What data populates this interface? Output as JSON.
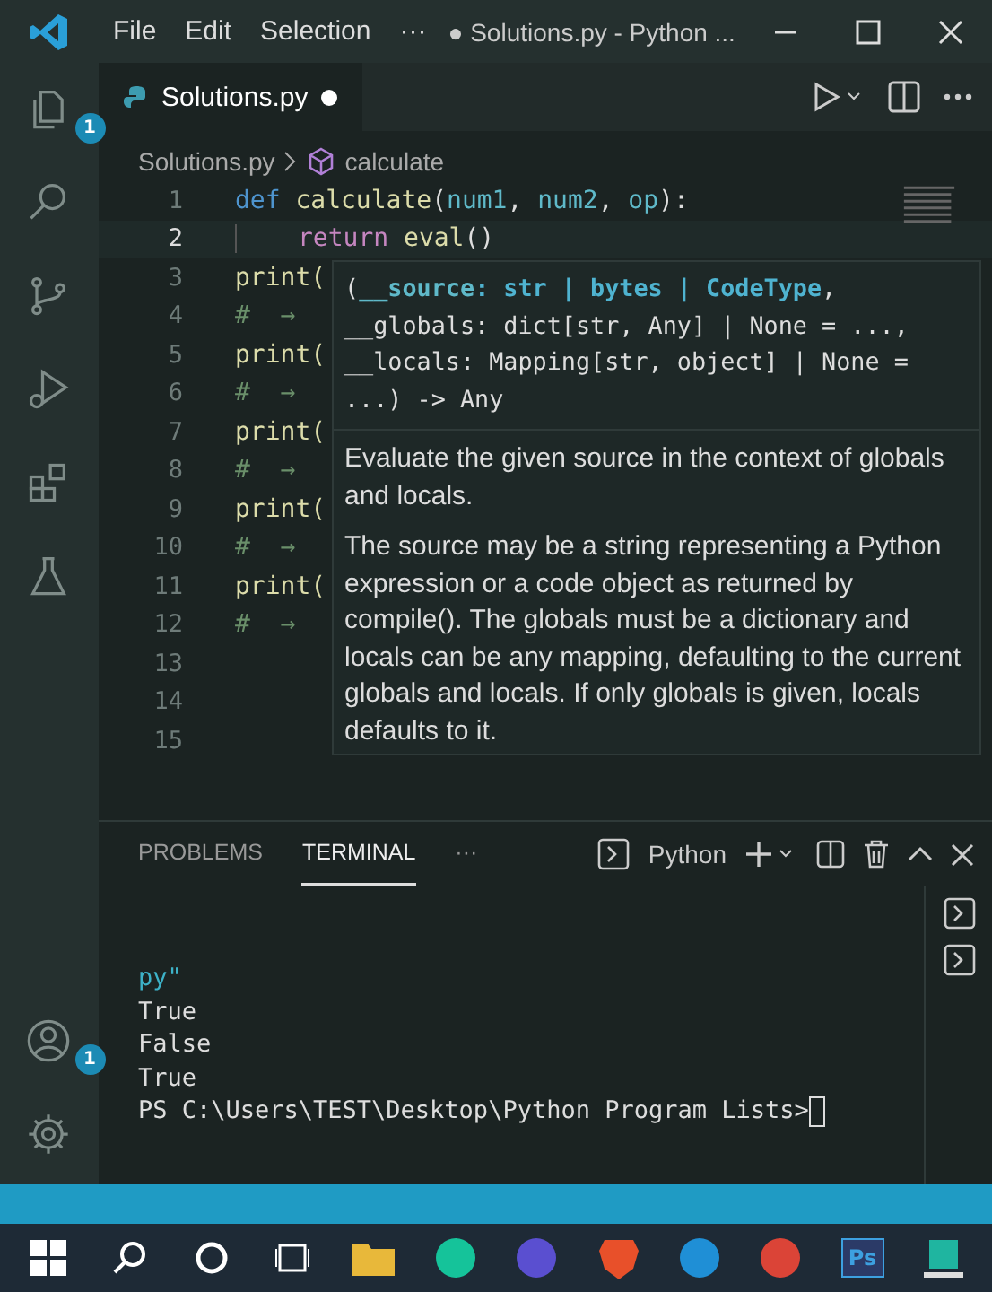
{
  "title_bar": {
    "menus": [
      "File",
      "Edit",
      "Selection"
    ],
    "more": "···",
    "title": "● Solutions.py - Python ..."
  },
  "activity_bar": {
    "items": [
      {
        "kind": "files",
        "badge": "1"
      },
      {
        "kind": "search"
      },
      {
        "kind": "source-control"
      },
      {
        "kind": "run-debug"
      },
      {
        "kind": "extensions"
      },
      {
        "kind": "testing"
      }
    ],
    "bottom": [
      {
        "kind": "account",
        "badge": "1"
      },
      {
        "kind": "settings"
      }
    ]
  },
  "editor_tabs": [
    {
      "label": "Solutions.py",
      "selected": true,
      "modified": true
    }
  ],
  "breadcrumb": {
    "file": "Solutions.py",
    "symbol": "calculate"
  },
  "code_lines": [
    {
      "number": "1",
      "current": false,
      "tokens": [
        {
          "kind": "keyword",
          "text": "def "
        },
        {
          "kind": "func",
          "text": "calculate"
        },
        {
          "kind": "plain",
          "text": "("
        },
        {
          "kind": "param",
          "text": "num1"
        },
        {
          "kind": "plain",
          "text": ", "
        },
        {
          "kind": "param",
          "text": "num2"
        },
        {
          "kind": "plain",
          "text": ", "
        },
        {
          "kind": "param",
          "text": "op"
        },
        {
          "kind": "plain",
          "text": "):"
        }
      ]
    },
    {
      "number": "2",
      "current": true,
      "indent": true,
      "tokens": [
        {
          "kind": "control",
          "text": "return "
        },
        {
          "kind": "func",
          "text": "eval"
        },
        {
          "kind": "plain",
          "text": "()"
        }
      ]
    },
    {
      "number": "3",
      "current": false,
      "tokens": [
        {
          "kind": "func",
          "text": "print("
        }
      ]
    },
    {
      "number": "4",
      "current": false,
      "tokens": [
        {
          "kind": "comment",
          "text": "#  →"
        }
      ]
    },
    {
      "number": "5",
      "current": false,
      "tokens": [
        {
          "kind": "func",
          "text": "print("
        }
      ]
    },
    {
      "number": "6",
      "current": false,
      "tokens": [
        {
          "kind": "comment",
          "text": "#  →"
        }
      ]
    },
    {
      "number": "7",
      "current": false,
      "tokens": [
        {
          "kind": "func",
          "text": "print("
        }
      ]
    },
    {
      "number": "8",
      "current": false,
      "tokens": [
        {
          "kind": "comment",
          "text": "#  →"
        }
      ]
    },
    {
      "number": "9",
      "current": false,
      "tokens": [
        {
          "kind": "func",
          "text": "print("
        }
      ]
    },
    {
      "number": "10",
      "current": false,
      "tokens": [
        {
          "kind": "comment",
          "text": "#  →"
        }
      ]
    },
    {
      "number": "11",
      "current": false,
      "tokens": [
        {
          "kind": "func",
          "text": "print("
        }
      ]
    },
    {
      "number": "12",
      "current": false,
      "tokens": [
        {
          "kind": "comment",
          "text": "#  →"
        }
      ]
    },
    {
      "number": "13",
      "current": false
    },
    {
      "number": "14",
      "current": false
    },
    {
      "number": "15",
      "current": false
    }
  ],
  "hover": {
    "signature": [
      {
        "kind": "plain",
        "text": "("
      },
      {
        "kind": "param",
        "text": "__source"
      },
      {
        "kind": "type",
        "text": ": str | bytes | CodeType"
      },
      {
        "kind": "plain",
        "text": ", __globals: dict[str, Any] | None = ..., __locals: Mapping[str, object] | None = ...) -> Any"
      }
    ],
    "paragraphs": [
      "Evaluate the given source in the context of globals and locals.",
      "The source may be a string representing a Python expression or a code object as returned by compile(). The globals must be a dictionary and locals can be any mapping, defaulting to the current globals and locals. If only globals is given, locals defaults to it."
    ]
  },
  "panel": {
    "tabs": [
      {
        "label": "PROBLEMS",
        "selected": false
      },
      {
        "label": "TERMINAL",
        "selected": true
      }
    ],
    "more": "···",
    "terminal_name": "Python",
    "lines": [
      {
        "kind": "path",
        "text": "py\""
      },
      {
        "kind": "output",
        "text": "True"
      },
      {
        "kind": "output",
        "text": "False"
      },
      {
        "kind": "output",
        "text": "True"
      },
      {
        "kind": "prompt",
        "text": "PS C:\\Users\\TEST\\Desktop\\Python Program Lists>"
      }
    ]
  },
  "taskbar": {
    "apps": [
      {
        "kind": "start"
      },
      {
        "kind": "search"
      },
      {
        "kind": "cortana"
      },
      {
        "kind": "task-view"
      },
      {
        "kind": "folder",
        "color": "#e8b83a"
      },
      {
        "kind": "circle",
        "color": "#15c39a"
      },
      {
        "kind": "circle",
        "color": "#5a4fd0"
      },
      {
        "kind": "shield",
        "color": "#e8502a"
      },
      {
        "kind": "circle",
        "color": "#1f8fd6"
      },
      {
        "kind": "circle",
        "color": "#db4437"
      },
      {
        "kind": "ps",
        "label": "Ps",
        "color": "#2b3a67"
      },
      {
        "kind": "editor",
        "color": "#1fb5a0"
      }
    ]
  }
}
